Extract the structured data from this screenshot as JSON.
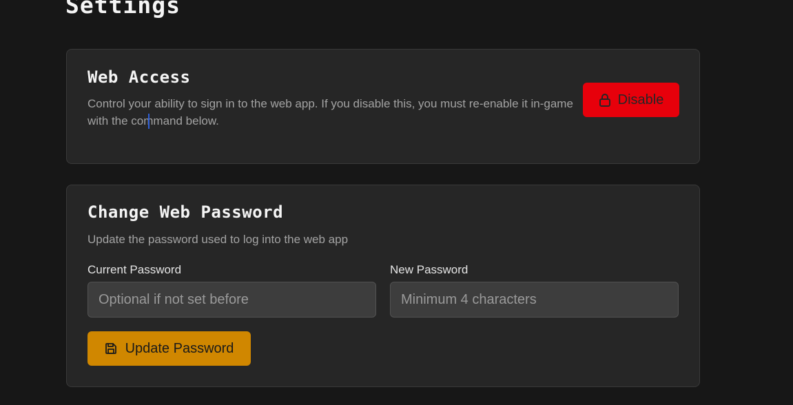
{
  "page": {
    "title": "Settings"
  },
  "web_access": {
    "title": "Web Access",
    "description": "Control your ability to sign in to the web app. If you disable this, you must re-enable it in-game with the command below.",
    "disable_button": {
      "label": "Disable",
      "icon": "lock-icon",
      "color": "#e7000b"
    }
  },
  "change_password": {
    "title": "Change Web Password",
    "description": "Update the password used to log into the web app",
    "current_password": {
      "label": "Current Password",
      "value": "",
      "placeholder": "Optional if not set before"
    },
    "new_password": {
      "label": "New Password",
      "value": "",
      "placeholder": "Minimum 4 characters"
    },
    "update_button": {
      "label": "Update Password",
      "icon": "save-icon",
      "color": "#d08700"
    }
  }
}
